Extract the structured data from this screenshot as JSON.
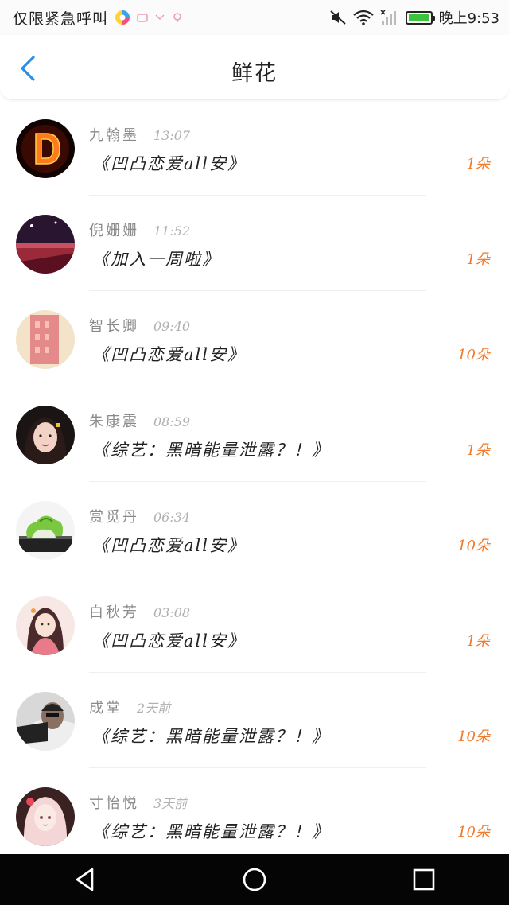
{
  "status_bar": {
    "carrier": "仅限紧急呼叫",
    "clock": "晚上9:53"
  },
  "header": {
    "title": "鲜花"
  },
  "colors": {
    "accent_blue": "#2a8ef0",
    "count_orange": "#f07a2a"
  },
  "items": [
    {
      "name": "九翰墨",
      "time": "13:07",
      "message": "《凹凸恋爱all安》",
      "count": "1朵",
      "avatar": "fire-letter-d-avatar"
    },
    {
      "name": "倪姗姗",
      "time": "11:52",
      "message": "《加入一周啦》",
      "count": "1朵",
      "avatar": "night-lake-avatar"
    },
    {
      "name": "智长卿",
      "time": "09:40",
      "message": "《凹凸恋爱all安》",
      "count": "10朵",
      "avatar": "pink-building-avatar"
    },
    {
      "name": "朱康震",
      "time": "08:59",
      "message": "《综艺：黑暗能量泄露？！》",
      "count": "1朵",
      "avatar": "girl-portrait-avatar"
    },
    {
      "name": "赏觅丹",
      "time": "06:34",
      "message": "《凹凸恋爱all安》",
      "count": "10朵",
      "avatar": "jade-cabbage-avatar"
    },
    {
      "name": "白秋芳",
      "time": "03:08",
      "message": "《凹凸恋爱all安》",
      "count": "1朵",
      "avatar": "anime-girl-avatar"
    },
    {
      "name": "成堂",
      "time": "2天前",
      "message": "《综艺：黑暗能量泄露？！》",
      "count": "10朵",
      "avatar": "man-photo-avatar"
    },
    {
      "name": "寸怡悦",
      "time": "3天前",
      "message": "《综艺：黑暗能量泄露？！》",
      "count": "10朵",
      "avatar": "pink-anime-avatar"
    }
  ]
}
